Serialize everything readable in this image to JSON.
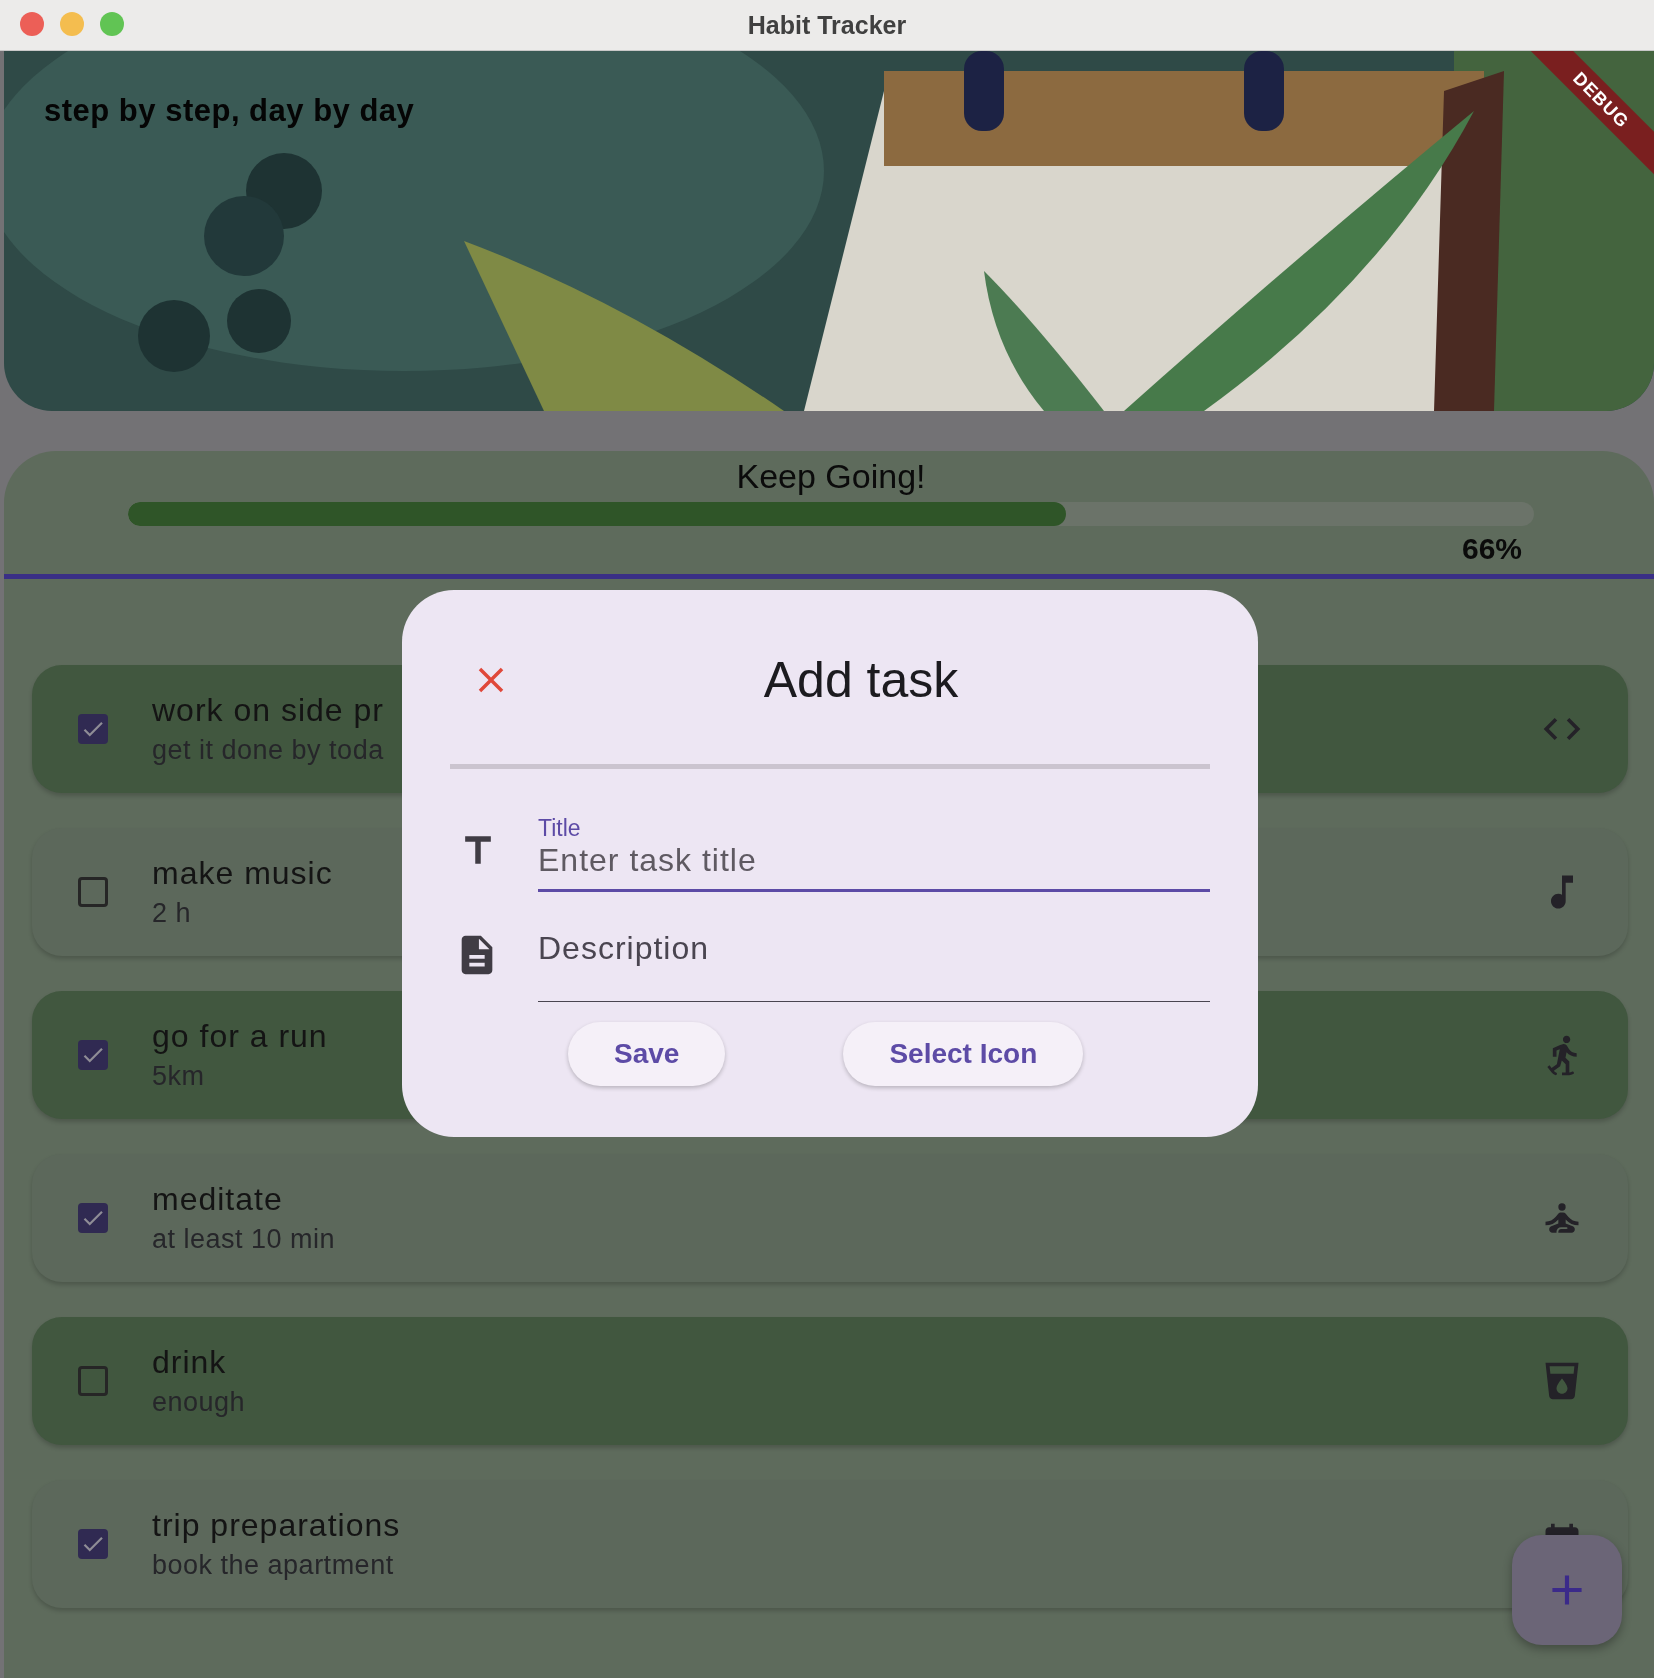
{
  "window": {
    "title": "Habit Tracker"
  },
  "debug_banner": {
    "text": "DEBUG"
  },
  "header": {
    "motto": "step by step, day by day"
  },
  "progress": {
    "title": "Keep Going!",
    "level": 0.667,
    "reading": "66%"
  },
  "tasks": [
    {
      "title": "work on side pr",
      "subtitle": "get it done by toda",
      "checked": true,
      "highlighted": true,
      "kind": "code"
    },
    {
      "title": "make music",
      "subtitle": "2 h",
      "checked": false,
      "highlighted": false,
      "kind": "music"
    },
    {
      "title": "go for a run",
      "subtitle": "5km",
      "checked": true,
      "highlighted": true,
      "kind": "run"
    },
    {
      "title": "meditate",
      "subtitle": "at least 10 min",
      "checked": true,
      "highlighted": false,
      "kind": "meditate"
    },
    {
      "title": "drink",
      "subtitle": "enough",
      "checked": false,
      "highlighted": true,
      "kind": "drink"
    },
    {
      "title": "trip preparations",
      "subtitle": "book the apartment",
      "checked": true,
      "highlighted": false,
      "kind": "calendar"
    }
  ],
  "dialog": {
    "title": "Add task",
    "title_field": {
      "label": "Title",
      "placeholder": "Enter task title"
    },
    "description_field": {
      "placeholder": "Description"
    },
    "buttons": [
      "Save",
      "Select Icon"
    ]
  }
}
